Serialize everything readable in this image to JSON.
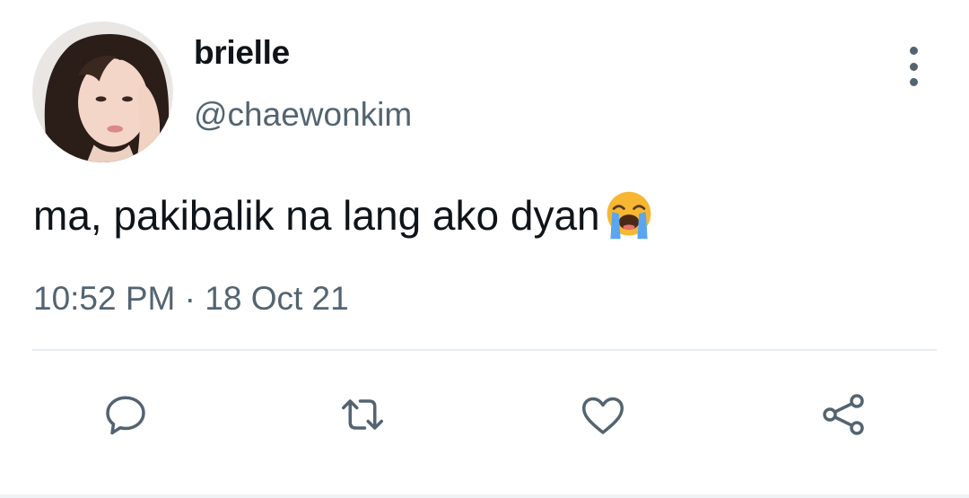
{
  "user": {
    "display_name": "brielle",
    "handle": "@chaewonkim",
    "avatar": "avatar-photo"
  },
  "tweet": {
    "text": "ma, pakibalik na lang ako dyan",
    "emoji": "loudly-crying-face-emoji",
    "time": "10:52 PM",
    "separator": "·",
    "date": "18 Oct 21"
  },
  "actions": {
    "icons": [
      "reply-icon",
      "retweet-icon",
      "like-icon",
      "share-icon"
    ]
  },
  "colors": {
    "text_primary": "#0f1419",
    "text_secondary": "#536471",
    "icon": "#536471",
    "divider": "#e6ecf0"
  }
}
